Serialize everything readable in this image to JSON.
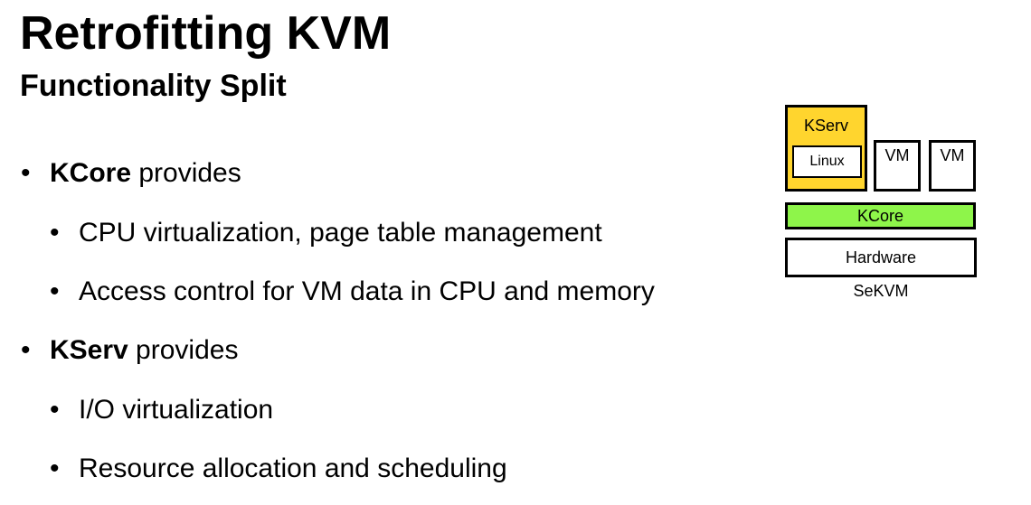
{
  "slide": {
    "title": "Retrofitting KVM",
    "subtitle": "Functionality Split"
  },
  "bullets": [
    {
      "level": 1,
      "bold": "KCore",
      "text": " provides"
    },
    {
      "level": 2,
      "bold": "",
      "text": "CPU virtualization, page table management"
    },
    {
      "level": 2,
      "bold": "",
      "text": "Access control for VM data in CPU and memory"
    },
    {
      "level": 1,
      "bold": "KServ",
      "text": " provides"
    },
    {
      "level": 2,
      "bold": "",
      "text": "I/O virtualization"
    },
    {
      "level": 2,
      "bold": "",
      "text": "Resource allocation and scheduling"
    }
  ],
  "bullet_glyph": "•",
  "diagram": {
    "kserv": "KServ",
    "linux": "Linux",
    "vm1": "VM",
    "vm2": "VM",
    "kcore": "KCore",
    "hardware": "Hardware",
    "caption": "SeKVM"
  },
  "colors": {
    "kserv_fill": "#FFD52E",
    "kcore_fill": "#8EF54A",
    "border": "#000000"
  }
}
